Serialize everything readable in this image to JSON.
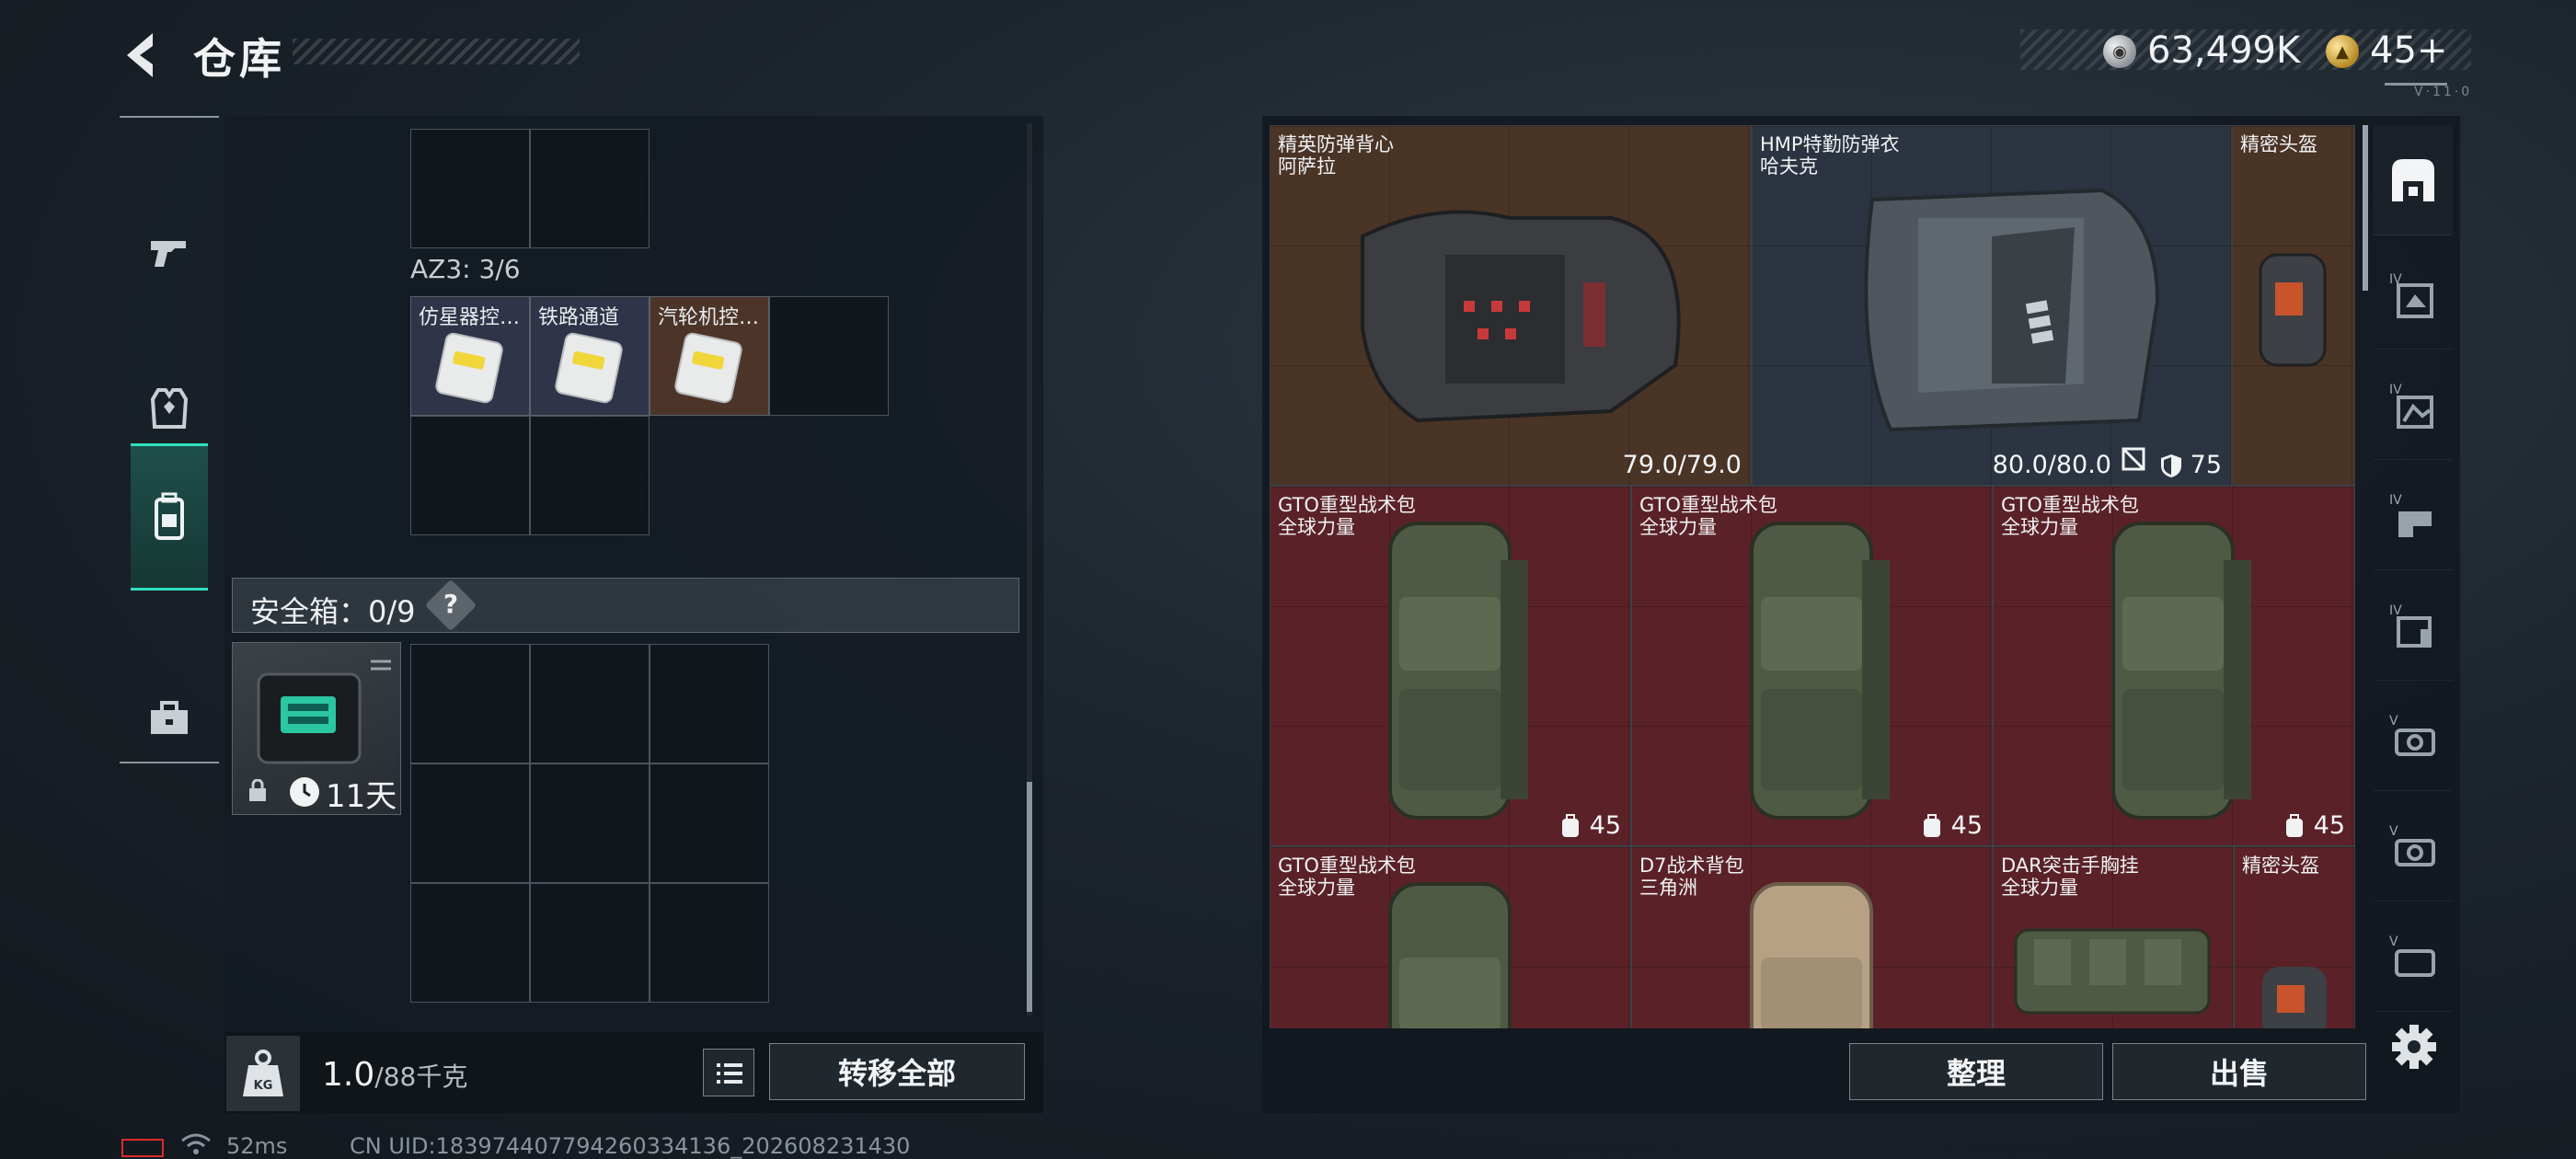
{
  "header": {
    "title": "仓库",
    "currency_silver": "63,499K",
    "currency_gold": "45+",
    "version": "V·11·0",
    "colors": {
      "accent": "#2ee0c0"
    }
  },
  "left_tabs": [
    {
      "name": "weapons",
      "icon": "pistol-icon"
    },
    {
      "name": "armor",
      "icon": "armor-vest-icon"
    },
    {
      "name": "backpack",
      "icon": "backpack-icon",
      "active": true
    },
    {
      "name": "supplies",
      "icon": "toolbox-icon"
    }
  ],
  "storage": {
    "az3_label": "AZ3: 3/6",
    "items": [
      {
        "name": "仿星器控…"
      },
      {
        "name": "铁路通道"
      },
      {
        "name": "汽轮机控…"
      }
    ],
    "safe_box_label": "安全箱：0/9",
    "safe_box_help": "?",
    "safe_timer": "11天"
  },
  "bottom": {
    "kg_label": "KG",
    "weight_value": "1.0",
    "weight_max": "/88千克",
    "transfer_all": "转移全部",
    "sort": "整理",
    "sell": "出售"
  },
  "status": {
    "ping": "52ms",
    "uid": "CN UID:183974407794260334136_202608231430"
  },
  "right_items": [
    {
      "line1": "精英防弹背心",
      "line2": "阿萨拉",
      "value": "79.0/79.0"
    },
    {
      "line1": "HMP特勤防弹衣",
      "line2": "哈夫克",
      "value": "80.0/80.0",
      "armor_level": "75"
    },
    {
      "line1": "精密头盔",
      "line2": ""
    },
    {
      "line1": "GTO重型战术包",
      "line2": "全球力量",
      "capacity": "45"
    },
    {
      "line1": "GTO重型战术包",
      "line2": "全球力量",
      "capacity": "45"
    },
    {
      "line1": "GTO重型战术包",
      "line2": "全球力量",
      "capacity": "45"
    },
    {
      "line1": "GTO重型战术包",
      "line2": "全球力量"
    },
    {
      "line1": "D7战术背包",
      "line2": "三角洲"
    },
    {
      "line1": "DAR突击手胸挂",
      "line2": "全球力量"
    },
    {
      "line1": "精密头盔",
      "line2": ""
    }
  ],
  "right_tabs": [
    {
      "name": "all",
      "icon": "all-items-icon",
      "active": true
    },
    {
      "name": "IV",
      "icon": "armor-level-iv-icon"
    },
    {
      "name": "IV",
      "icon": "helmet-level-iv-icon"
    },
    {
      "name": "IV",
      "icon": "rig-level-iv-icon"
    },
    {
      "name": "IV",
      "icon": "backpack-level-iv-icon"
    },
    {
      "name": "V",
      "icon": "armor-level-v-icon"
    },
    {
      "name": "V",
      "icon": "helmet-level-v-icon"
    },
    {
      "name": "V",
      "icon": "rig-level-v-icon"
    }
  ]
}
